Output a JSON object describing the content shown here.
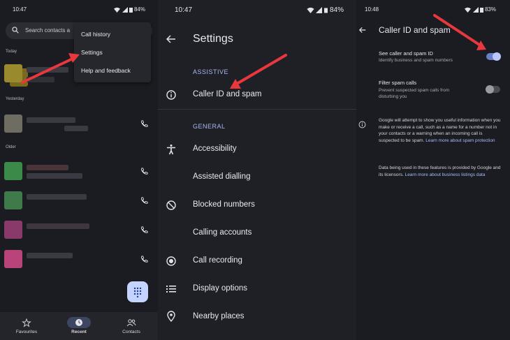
{
  "colors": {
    "accent": "#a9bdfb",
    "arrow": "#e8383d",
    "fab": "#c4d4ff",
    "toggle_on": "#8ea7f5"
  },
  "panel1": {
    "time": "10:47",
    "battery": "84%",
    "search_placeholder": "Search contacts a",
    "sections": {
      "today": "Today",
      "yesterday": "Yesterday",
      "older": "Older"
    },
    "menu": [
      {
        "label": "Call history"
      },
      {
        "label": "Settings"
      },
      {
        "label": "Help and feedback"
      }
    ],
    "nav": [
      {
        "label": "Favourites",
        "icon": "star-icon"
      },
      {
        "label": "Recent",
        "icon": "clock-icon",
        "active": true
      },
      {
        "label": "Contacts",
        "icon": "people-icon"
      }
    ]
  },
  "panel2": {
    "time": "10:47",
    "battery": "84%",
    "title": "Settings",
    "section_assistive": "ASSISTIVE",
    "section_general": "GENERAL",
    "items": [
      {
        "label": "Caller ID and spam",
        "icon": "info-icon"
      },
      {
        "label": "Accessibility",
        "icon": "accessibility-icon"
      },
      {
        "label": "Assisted dialling",
        "icon": ""
      },
      {
        "label": "Blocked numbers",
        "icon": "block-icon"
      },
      {
        "label": "Calling accounts",
        "icon": ""
      },
      {
        "label": "Call recording",
        "icon": "record-icon"
      },
      {
        "label": "Display options",
        "icon": "list-icon"
      },
      {
        "label": "Nearby places",
        "icon": "location-pin-icon"
      }
    ]
  },
  "panel3": {
    "time": "10:48",
    "battery": "83%",
    "title": "Caller ID and spam",
    "see_caller_label": "See caller and spam ID",
    "see_caller_sub": "Identify business and spam numbers",
    "see_caller_on": true,
    "filter_label": "Filter spam calls",
    "filter_sub": "Prevent suspected spam calls from disturbing you",
    "filter_on": false,
    "info_text": "Google will attempt to show you useful information when you make or receive a call, such as a name for a number not in your contacts or a warning when an incoming call is suspected to be spam.",
    "info_link": "Learn more about spam protection",
    "data_text": "Data being used in these features is provided by Google and its licensors.",
    "data_link": "Learn more about business listings data"
  }
}
